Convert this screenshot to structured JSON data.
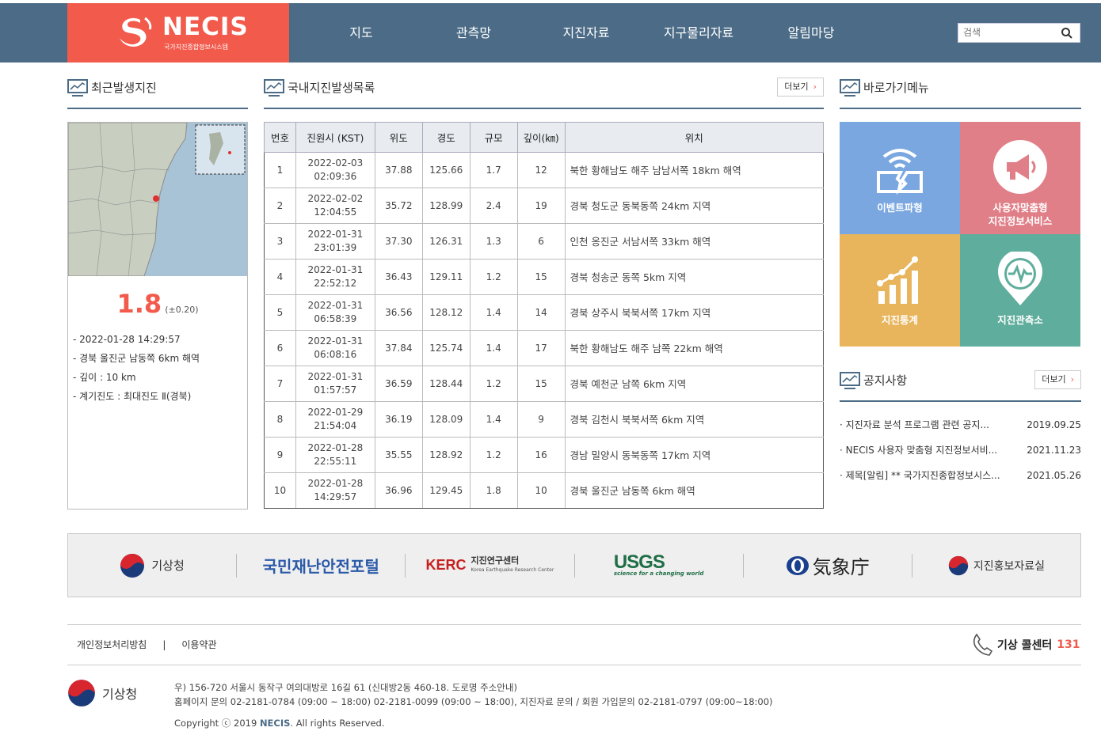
{
  "header": {
    "brand": "NECIS",
    "brand_sub": "국가지진종합정보시스템",
    "nav": [
      "지도",
      "관측망",
      "지진자료",
      "지구물리자료",
      "알림마당"
    ],
    "search_placeholder": "검색"
  },
  "recent": {
    "title": "최근발생지진",
    "magnitude": "1.8",
    "error": "(±0.20)",
    "details": [
      "- 2022-01-28 14:29:57",
      "- 경북 울진군 남동쪽 6km 해역",
      "- 깊이 : 10 km",
      "- 계기진도 : 최대진도 Ⅱ(경북)"
    ]
  },
  "domestic": {
    "title": "국내지진발생목록",
    "more": "더보기",
    "headers": [
      "번호",
      "진원시 (KST)",
      "위도",
      "경도",
      "규모",
      "깊이(㎞)",
      "위치"
    ],
    "rows": [
      {
        "no": "1",
        "date": "2022-02-03",
        "time": "02:09:36",
        "lat": "37.88",
        "lon": "125.66",
        "mag": "1.7",
        "depth": "12",
        "loc": "북한 황해남도 해주 남남서쪽 18km 해역"
      },
      {
        "no": "2",
        "date": "2022-02-02",
        "time": "12:04:55",
        "lat": "35.72",
        "lon": "128.99",
        "mag": "2.4",
        "depth": "19",
        "loc": "경북 청도군 동북동쪽 24km 지역"
      },
      {
        "no": "3",
        "date": "2022-01-31",
        "time": "23:01:39",
        "lat": "37.30",
        "lon": "126.31",
        "mag": "1.3",
        "depth": "6",
        "loc": "인천 옹진군 서남서쪽 33km 해역"
      },
      {
        "no": "4",
        "date": "2022-01-31",
        "time": "22:52:12",
        "lat": "36.43",
        "lon": "129.11",
        "mag": "1.2",
        "depth": "15",
        "loc": "경북 청송군 동쪽 5km 지역"
      },
      {
        "no": "5",
        "date": "2022-01-31",
        "time": "06:58:39",
        "lat": "36.56",
        "lon": "128.12",
        "mag": "1.4",
        "depth": "14",
        "loc": "경북 상주시 북북서쪽 17km 지역"
      },
      {
        "no": "6",
        "date": "2022-01-31",
        "time": "06:08:16",
        "lat": "37.84",
        "lon": "125.74",
        "mag": "1.4",
        "depth": "17",
        "loc": "북한 황해남도 해주 남쪽 22km 해역"
      },
      {
        "no": "7",
        "date": "2022-01-31",
        "time": "01:57:57",
        "lat": "36.59",
        "lon": "128.44",
        "mag": "1.2",
        "depth": "15",
        "loc": "경북 예천군 남쪽 6km 지역"
      },
      {
        "no": "8",
        "date": "2022-01-29",
        "time": "21:54:04",
        "lat": "36.19",
        "lon": "128.09",
        "mag": "1.4",
        "depth": "9",
        "loc": "경북 김천시 북북서쪽 6km 지역"
      },
      {
        "no": "9",
        "date": "2022-01-28",
        "time": "22:55:11",
        "lat": "35.55",
        "lon": "128.92",
        "mag": "1.2",
        "depth": "16",
        "loc": "경남 밀양시 동북동쪽 17km 지역"
      },
      {
        "no": "10",
        "date": "2022-01-28",
        "time": "14:29:57",
        "lat": "36.96",
        "lon": "129.45",
        "mag": "1.8",
        "depth": "10",
        "loc": "경북 울진군 남동쪽 6km 해역"
      }
    ]
  },
  "quick": {
    "title": "바로가기메뉴",
    "tiles": [
      {
        "label": "이벤트파형",
        "color": "#7aa7e0",
        "icon": "wifi-alert-icon"
      },
      {
        "label": "사용자맞춤형",
        "label2": "지진정보서비스",
        "color": "#e07f88",
        "icon": "megaphone-icon"
      },
      {
        "label": "지진통계",
        "color": "#e8b55d",
        "icon": "chart-icon"
      },
      {
        "label": "지진관측소",
        "color": "#5fad9c",
        "icon": "location-pulse-icon"
      }
    ]
  },
  "notices": {
    "title": "공지사항",
    "more": "더보기",
    "items": [
      {
        "text": "· 지진자료 분석 프로그램 관련 공지...",
        "date": "2019.09.25"
      },
      {
        "text": "· NECIS 사용자 맞춤형 지진정보서비...",
        "date": "2021.11.23"
      },
      {
        "text": "· 제목[알림] ** 국가지진종합정보시스...",
        "date": "2021.05.26"
      }
    ]
  },
  "partners": {
    "kma": "기상청",
    "safety": "국민재난안전포털",
    "kerc": "KERC",
    "kerc_name": "지진연구센터",
    "kerc_sub": "Korea Earthquake Research Center",
    "usgs": "USGS",
    "usgs_sub": "science for a changing world",
    "jma": "気象庁",
    "promo": "지진홍보자료실"
  },
  "footer": {
    "privacy": "개인정보처리방침",
    "sep": "|",
    "terms": "이용약관",
    "call_label": "기상 콜센터",
    "call_num": "131",
    "logo_text": "기상청",
    "addr1": "우) 156-720 서울시 동작구 여의대방로 16길 61 (신대방2동 460-18. 도로명 주소안내)",
    "addr2": "홈페이지 문의 02-2181-0784 (09:00 ~ 18:00) 02-2181-0099 (09:00 ~ 18:00), 지진자료 문의 / 회원 가입문의 02-2181-0797 (09:00~18:00)",
    "copy_prefix": "Copyright ⓒ 2019",
    "copy_brand": "NECIS",
    "copy_suffix": ". All rights Reserved."
  },
  "colors": {
    "header": "#4b6b86",
    "accent": "#f25a4c"
  }
}
